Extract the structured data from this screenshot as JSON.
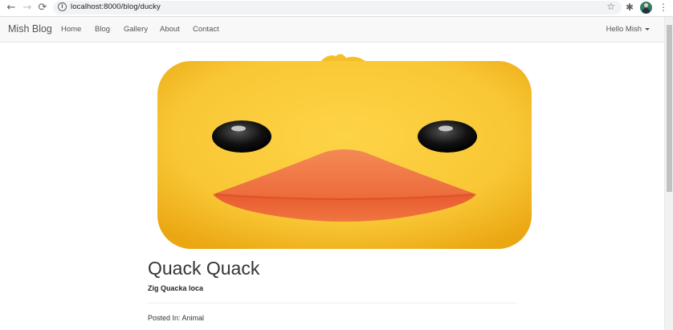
{
  "browser": {
    "url": "localhost:8000/blog/ducky",
    "back_icon": "←",
    "forward_icon": "→",
    "reload_icon": "⟳",
    "info_icon": "i",
    "star_icon": "☆",
    "extensions_icon": "✱",
    "menu_icon": "⋮"
  },
  "navbar": {
    "brand": "Mish Blog",
    "links": [
      "Home",
      "Blog",
      "Gallery",
      "About",
      "Contact"
    ],
    "user": "Hello Mish"
  },
  "post": {
    "image_alt": "duck face",
    "title": "Quack Quack",
    "subtitle": "Zig Quacka loca",
    "posted_in": "Posted In: Animal"
  },
  "colors": {
    "duck_yellow": "#f9c735",
    "beak_orange": "#f07a45",
    "navbar_bg": "#f8f8f8"
  }
}
